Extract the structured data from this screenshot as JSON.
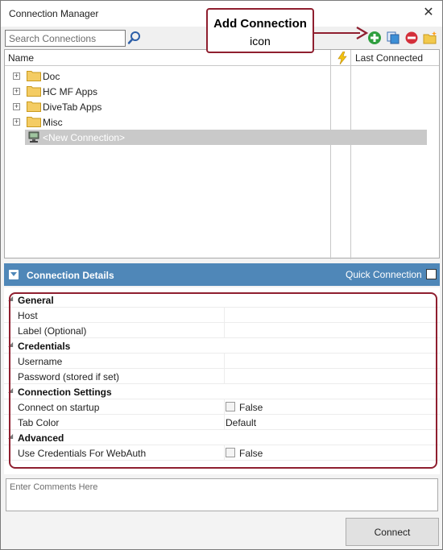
{
  "window": {
    "title": "Connection Manager",
    "close_glyph": "✕"
  },
  "toolbar": {
    "search_placeholder": "Search Connections",
    "icons": [
      "search-icon",
      "add-connection-icon",
      "copy-connection-icon",
      "remove-connection-icon",
      "new-folder-icon"
    ]
  },
  "tree": {
    "columns": {
      "name": "Name",
      "status_icon": "lightning-icon",
      "last_connected": "Last Connected"
    },
    "folders": [
      {
        "label": "Doc",
        "expander": "+"
      },
      {
        "label": "HC MF Apps",
        "expander": "+"
      },
      {
        "label": "DiveTab Apps",
        "expander": "+"
      },
      {
        "label": "Misc",
        "expander": "+"
      }
    ],
    "selected_item": "<New Connection>"
  },
  "details": {
    "title": "Connection Details",
    "quick_connection_label": "Quick Connection",
    "quick_connection_checked": false,
    "categories": {
      "general": "General",
      "credentials": "Credentials",
      "connection_settings": "Connection Settings",
      "advanced": "Advanced"
    },
    "properties": {
      "host": {
        "label": "Host",
        "value": ""
      },
      "label": {
        "label": "Label (Optional)",
        "value": ""
      },
      "username": {
        "label": "Username",
        "value": ""
      },
      "password": {
        "label": "Password (stored if set)",
        "value": ""
      },
      "connect_on_startup": {
        "label": "Connect on startup",
        "value": "False"
      },
      "tab_color": {
        "label": "Tab Color",
        "value": "Default"
      },
      "use_credentials_webauth": {
        "label": "Use Credentials For WebAuth",
        "value": "False"
      }
    }
  },
  "comments": {
    "placeholder": "Enter Comments Here"
  },
  "connect_button": "Connect",
  "annotation": {
    "title": "Add Connection",
    "subtitle": "icon",
    "color": "#8f1f2f"
  },
  "colors": {
    "header_blue": "#4f87b8",
    "selection_gray": "#c9c9c9",
    "add_green": "#2e9e3e",
    "remove_red": "#d32f3a"
  }
}
